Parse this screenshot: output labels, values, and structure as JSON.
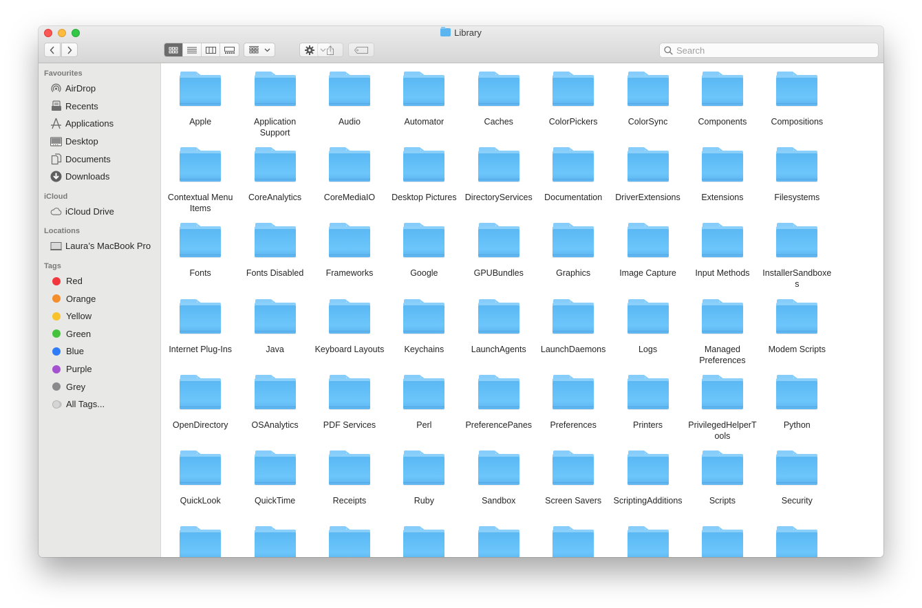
{
  "window": {
    "title": "Library"
  },
  "toolbar": {
    "back_icon": "chevron-left",
    "forward_icon": "chevron-right",
    "view_modes": [
      "icon-view",
      "list-view",
      "column-view",
      "gallery-view"
    ],
    "active_view": "icon-view",
    "group_icon": "group-by",
    "action_icon": "gear",
    "share_icon": "share",
    "tag_icon": "tag",
    "search": {
      "placeholder": "Search",
      "value": ""
    }
  },
  "sidebar": {
    "sections": [
      {
        "heading": "Favourites",
        "items": [
          {
            "label": "AirDrop",
            "icon": "airdrop-icon"
          },
          {
            "label": "Recents",
            "icon": "recents-icon"
          },
          {
            "label": "Applications",
            "icon": "applications-icon"
          },
          {
            "label": "Desktop",
            "icon": "desktop-icon"
          },
          {
            "label": "Documents",
            "icon": "documents-icon"
          },
          {
            "label": "Downloads",
            "icon": "downloads-icon"
          }
        ]
      },
      {
        "heading": "iCloud",
        "items": [
          {
            "label": "iCloud Drive",
            "icon": "cloud-icon"
          }
        ]
      },
      {
        "heading": "Locations",
        "items": [
          {
            "label": "Laura’s MacBook Pro",
            "icon": "laptop-icon"
          }
        ]
      },
      {
        "heading": "Tags",
        "items": [
          {
            "label": "Red",
            "color": "#f2373e"
          },
          {
            "label": "Orange",
            "color": "#f48e2d"
          },
          {
            "label": "Yellow",
            "color": "#f8c22c"
          },
          {
            "label": "Green",
            "color": "#47c23e"
          },
          {
            "label": "Blue",
            "color": "#2f7cf6"
          },
          {
            "label": "Purple",
            "color": "#a552d0"
          },
          {
            "label": "Grey",
            "color": "#8a8a8d"
          },
          {
            "label": "All Tags...",
            "color": "all"
          }
        ]
      }
    ]
  },
  "folders": [
    "Apple",
    "Application Support",
    "Audio",
    "Automator",
    "Caches",
    "ColorPickers",
    "ColorSync",
    "Components",
    "Compositions",
    "Contextual Menu Items",
    "CoreAnalytics",
    "CoreMediaIO",
    "Desktop Pictures",
    "DirectoryServices",
    "Documentation",
    "DriverExtensions",
    "Extensions",
    "Filesystems",
    "Fonts",
    "Fonts Disabled",
    "Frameworks",
    "Google",
    "GPUBundles",
    "Graphics",
    "Image Capture",
    "Input Methods",
    "InstallerSandboxes",
    "Internet Plug-Ins",
    "Java",
    "Keyboard Layouts",
    "Keychains",
    "LaunchAgents",
    "LaunchDaemons",
    "Logs",
    "Managed Preferences",
    "Modem Scripts",
    "OpenDirectory",
    "OSAnalytics",
    "PDF Services",
    "Perl",
    "PreferencePanes",
    "Preferences",
    "Printers",
    "PrivilegedHelperTools",
    "Python",
    "QuickLook",
    "QuickTime",
    "Receipts",
    "Ruby",
    "Sandbox",
    "Screen Savers",
    "ScriptingAdditions",
    "Scripts",
    "Security",
    "",
    "",
    "",
    "",
    "",
    "",
    "",
    "",
    ""
  ]
}
